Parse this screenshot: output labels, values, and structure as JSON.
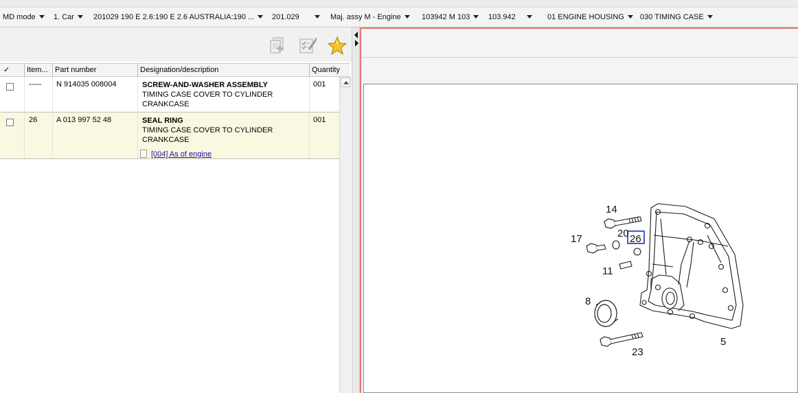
{
  "toolbar": {
    "items": [
      {
        "label": "MD mode"
      },
      {
        "label": "1. Car"
      },
      {
        "label": "201029 190 E 2.6:190 E 2.6 AUSTRALIA:190 ..."
      },
      {
        "label": "201.029"
      },
      {
        "label": "Maj. assy M  - Engine"
      },
      {
        "label": "103942 M 103"
      },
      {
        "label": "103.942"
      },
      {
        "label": "01 ENGINE HOUSING"
      },
      {
        "label": "030 TIMING CASE"
      }
    ]
  },
  "icons": {
    "add": "add-document-icon",
    "edit": "edit-checklist-icon",
    "favorite": "favorite-star-icon",
    "favorite_color": "#f0c020"
  },
  "grid": {
    "headers": {
      "check": "✓",
      "item": "Item...",
      "part": "Part number",
      "desc": "Designation/description",
      "qty": "Quantity"
    },
    "rows": [
      {
        "item": "-----",
        "part": "N 914035 008004",
        "title": "SCREW-AND-WASHER ASSEMBLY",
        "line1": "TIMING CASE COVER TO CYLINDER",
        "line2": "CRANKCASE",
        "qty": "001",
        "note": ""
      },
      {
        "item": "26",
        "part": "A 013 997 52 48",
        "title": "SEAL RING",
        "line1": "TIMING CASE COVER TO CYLINDER",
        "line2": "CRANKCASE",
        "qty": "001",
        "note": "[004] As of engine"
      }
    ],
    "selected_row_color": "#fbf8e1"
  },
  "diagram": {
    "callouts": {
      "c14": "14",
      "c20": "20",
      "c26": "26",
      "c17": "17",
      "c11": "11",
      "c8": "8",
      "c5": "5",
      "c23": "23"
    },
    "highlight_color": "#1b2fd0"
  }
}
